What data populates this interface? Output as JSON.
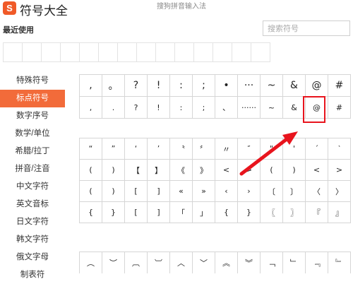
{
  "app": {
    "logo": "S",
    "title": "符号大全",
    "ime_title": "搜狗拼音输入法"
  },
  "recent": {
    "label": "最近使用",
    "slots": 14
  },
  "search": {
    "placeholder": "搜索符号"
  },
  "categories": [
    {
      "label": "特殊符号",
      "active": false
    },
    {
      "label": "标点符号",
      "active": true
    },
    {
      "label": "数字序号",
      "active": false
    },
    {
      "label": "数学/单位",
      "active": false
    },
    {
      "label": "希腊/拉丁",
      "active": false
    },
    {
      "label": "拼音/注音",
      "active": false
    },
    {
      "label": "中文字符",
      "active": false
    },
    {
      "label": "英文音标",
      "active": false
    },
    {
      "label": "日文字符",
      "active": false
    },
    {
      "label": "韩文字符",
      "active": false
    },
    {
      "label": "俄文字母",
      "active": false
    },
    {
      "label": "制表符",
      "active": false
    }
  ],
  "grid1": [
    [
      ",",
      "。",
      "?",
      "!",
      ":",
      ";",
      "•",
      "···",
      "~",
      "&",
      "@",
      "#"
    ],
    [
      ",",
      ".",
      "?",
      "!",
      ":",
      ";",
      "、",
      "······",
      "~",
      "&",
      "@",
      "#"
    ]
  ],
  "grid2": [
    [
      "“",
      "”",
      "‘",
      "’",
      "〝",
      "〞",
      "〃",
      "″",
      "\"",
      "'",
      "´",
      "‵"
    ],
    [
      "(",
      ")",
      "【",
      "】",
      "《",
      "》",
      "<",
      ">",
      "(",
      ")",
      "<",
      ">"
    ],
    [
      "(",
      ")",
      "[",
      "]",
      "«",
      "»",
      "‹",
      "›",
      "〔",
      "〕",
      "〈",
      "〉"
    ],
    [
      "{",
      "}",
      "[",
      "]",
      "「",
      "」",
      "{",
      "}",
      "〖",
      "〗",
      "『",
      "』"
    ]
  ],
  "grid3": [
    [
      "︵",
      "︶",
      "︹",
      "︺",
      "︿",
      "﹀",
      "︽",
      "︾",
      "﹁",
      "﹂",
      "﹃",
      "﹄"
    ]
  ],
  "colors": {
    "accent": "#f26b3a",
    "highlight": "#e8141d"
  }
}
